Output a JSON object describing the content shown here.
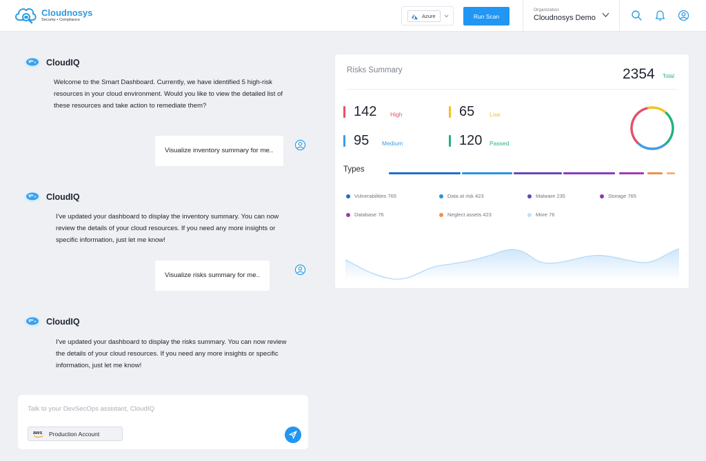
{
  "header": {
    "brand_name": "Cloudnosys",
    "brand_tagline": "Security • Compliance",
    "cloud_provider": "Azure",
    "run_scan_label": "Run Scan",
    "org_label": "Organization",
    "org_name": "Cloudnosys Demo",
    "icons": [
      "search-icon",
      "bell-icon",
      "user-icon"
    ]
  },
  "chat": {
    "bot_name": "CloudIQ",
    "messages": [
      {
        "role": "bot",
        "text": "Welcome to the Smart Dashboard. Currently, we have identified 5 high-risk resources in your cloud environment. Would you like to view the detailed list of these resources and take action to remediate them?"
      },
      {
        "role": "user",
        "text": "Visualize inventory summary for me.."
      },
      {
        "role": "bot",
        "text": "I've updated your dashboard to display the inventory summary. You can now review the details of your cloud resources. If you need any more insights or specific information, just let me know!"
      },
      {
        "role": "user",
        "text": "Visualize risks summary for me.."
      },
      {
        "role": "bot",
        "text": "I've updated your dashboard to display the risks summary. You can now review the details of your cloud resources. If you need any more insights or specific information, just let me know!"
      }
    ],
    "input_value": "",
    "input_placeholder": "Talk to your DevSecOps assistant, CloudIQ",
    "account_label": "Production Account"
  },
  "risks": {
    "title": "Risks Summary",
    "total": "2354",
    "total_label": "Total",
    "stats": [
      {
        "value": "142",
        "label": "High",
        "color": "#e5506b"
      },
      {
        "value": "65",
        "label": "Low",
        "color": "#f4c21c"
      },
      {
        "value": "95",
        "label": "Medium",
        "color": "#3d9be6"
      },
      {
        "value": "120",
        "label": "Passed",
        "color": "#22b27c"
      }
    ],
    "types_title": "Types",
    "types": [
      {
        "label": "Vulnerabilities 765",
        "color": "#1e6fce"
      },
      {
        "label": "Data  at risk 423",
        "color": "#2494e0"
      },
      {
        "label": "Malware 235",
        "color": "#6347b5"
      },
      {
        "label": "Storage 765",
        "color": "#8a3ab9"
      },
      {
        "label": "Database 76",
        "color": "#a03ab0"
      },
      {
        "label": "Neglect assets 423",
        "color": "#ef8f4c"
      },
      {
        "label": "More 76",
        "color": "#bfe1f7"
      }
    ]
  }
}
